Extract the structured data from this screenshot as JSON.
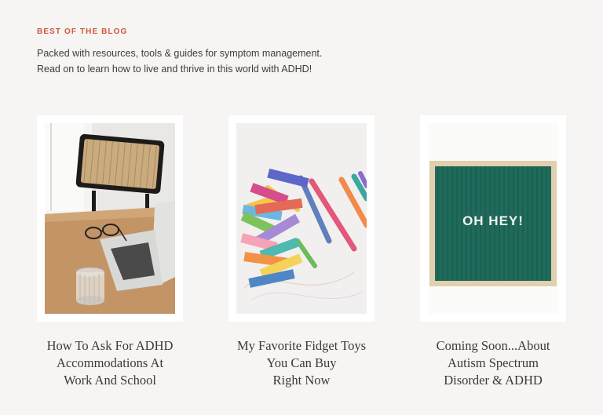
{
  "section": {
    "kicker": "BEST OF THE BLOG",
    "intro": "Packed with resources, tools & guides for symptom management. Read on to learn how to live and thrive in this world with ADHD!"
  },
  "posts": [
    {
      "title_lines": [
        "How To Ask For ADHD",
        "Accommodations At",
        "Work And School"
      ],
      "image_icon": "desk-laptop-photo"
    },
    {
      "title_lines": [
        "My Favorite Fidget Toys",
        "You Can Buy",
        "Right Now"
      ],
      "image_icon": "colorful-blocks-markers-photo"
    },
    {
      "title_lines": [
        "Coming Soon...About",
        "Autism Spectrum",
        "Disorder & ADHD"
      ],
      "image_icon": "letter-board-photo",
      "image_text": "OH HEY!"
    }
  ],
  "colors": {
    "accent": "#d1573a",
    "background": "#f6f5f3",
    "letterboard_green": "#1f6b5b"
  }
}
